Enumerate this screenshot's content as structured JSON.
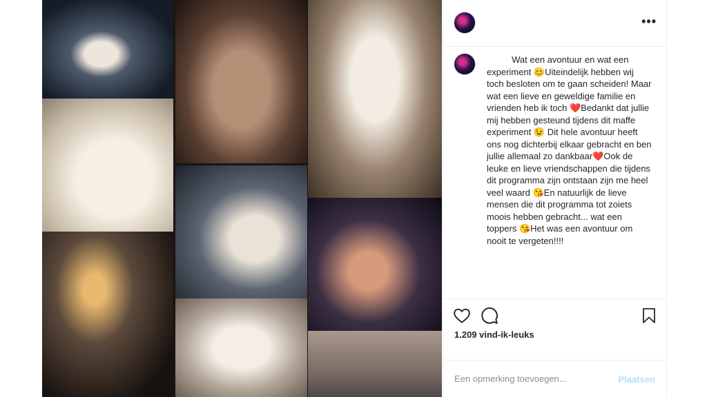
{
  "post": {
    "caption": "          Wat een avontuur en wat een experiment 😊Uiteindelijk hebben wij toch besloten om te gaan scheiden! Maar wat een lieve en geweldige familie en vrienden heb ik toch ❤️Bedankt dat jullie mij hebben gesteund tijdens dit maffe experiment 😉 Dit hele avontuur heeft ons nog dichterbij elkaar gebracht en ben jullie allemaal zo dankbaar❤️Ook de leuke en lieve vriendschappen die tijdens dit programma zijn ontstaan zijn me heel veel waard 😘En natuurlijk de lieve mensen die dit programma tot zoiets moois hebben gebracht... wat een toppers 😘Het was een avontuur om nooit te vergeten!!!!",
    "likes": "1.209 vind-ik-leuks"
  },
  "icons": {
    "more": "more-options-icon",
    "like": "heart-icon",
    "comment": "comment-icon",
    "save": "bookmark-icon"
  },
  "comment_box": {
    "placeholder": "Een opmerking toevoegen...",
    "post_label": "Plaatsen"
  },
  "colors": {
    "post_button_disabled": "#b2dffc",
    "text": "#262626",
    "muted": "#8e8e8e"
  }
}
